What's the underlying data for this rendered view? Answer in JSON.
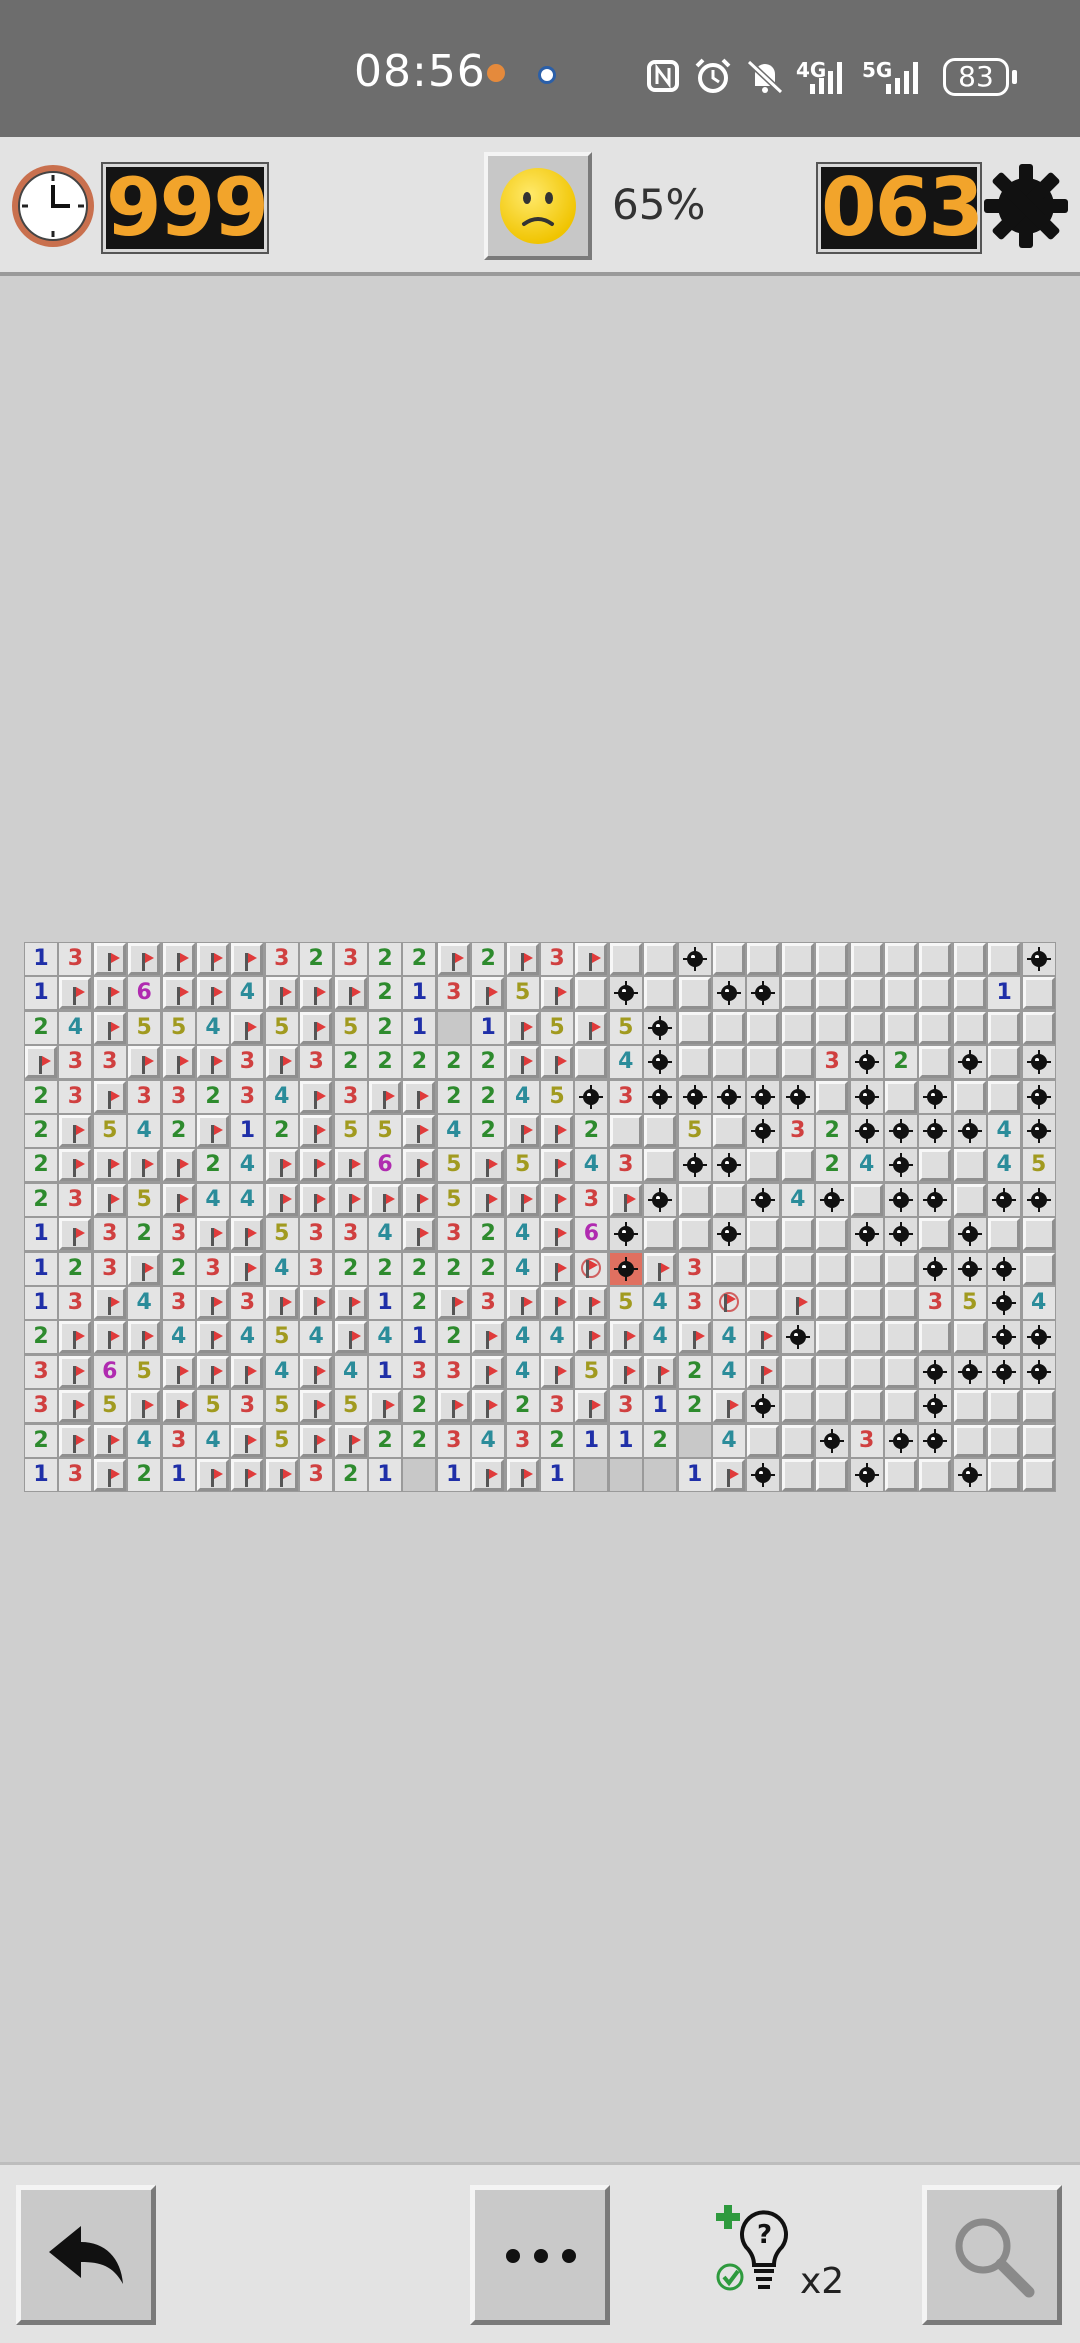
{
  "status_bar": {
    "time": "08:56",
    "network1": "4G",
    "network2": "5G",
    "battery": "83"
  },
  "header": {
    "timer": "999",
    "progress": "65%",
    "mines_remaining": "063",
    "face": "worried-face-icon"
  },
  "board": {
    "cols": 30,
    "rows": 16,
    "legend": "digit = revealed number, F = flag, M = mine, X = exploded mine, W = wrong flag, . = revealed empty, # = covered",
    "grid": [
      "13FFFFF32322F2F3F##M#########M",
      "1FF6FF4FFF213F5F#M##MM######1#",
      "24F554F5F521.1F5F5M###########",
      "F33FFF3F322222FF#4M####3M2#M#M",
      "23F33234F3FF2245M3MMMMM#M#M##M",
      "2F542F12F55F42FF2##5#M32MMMM4M",
      "2FFFF24FFF6F5F5F43#MM##24M##45M",
      "23F5F44FFFFF5FFF3FM##M4M#MM#MM3",
      "1F323FF5334F324F6M##M###MM#M##M",
      "123F23F43222224FWXF3######MMM##",
      "13F43F3FFF12F3FFF543W F###35M4M",
      "2FFF4F454F412F44FF4F4FM#####MM5M",
      "3F65FFF4F4133F4F5FF24F####MMMMM",
      "3F5FF535F5F2FF23F312FM####M###",
      "2FF434F5FF223432112.4##M3MM###",
      "13F21FFF321.1FF1...1FM##M##M##"
    ]
  },
  "bottom_bar": {
    "undo": "undo-icon",
    "more": "more-icon",
    "hint_count": "x2",
    "zoom": "zoom-icon"
  }
}
